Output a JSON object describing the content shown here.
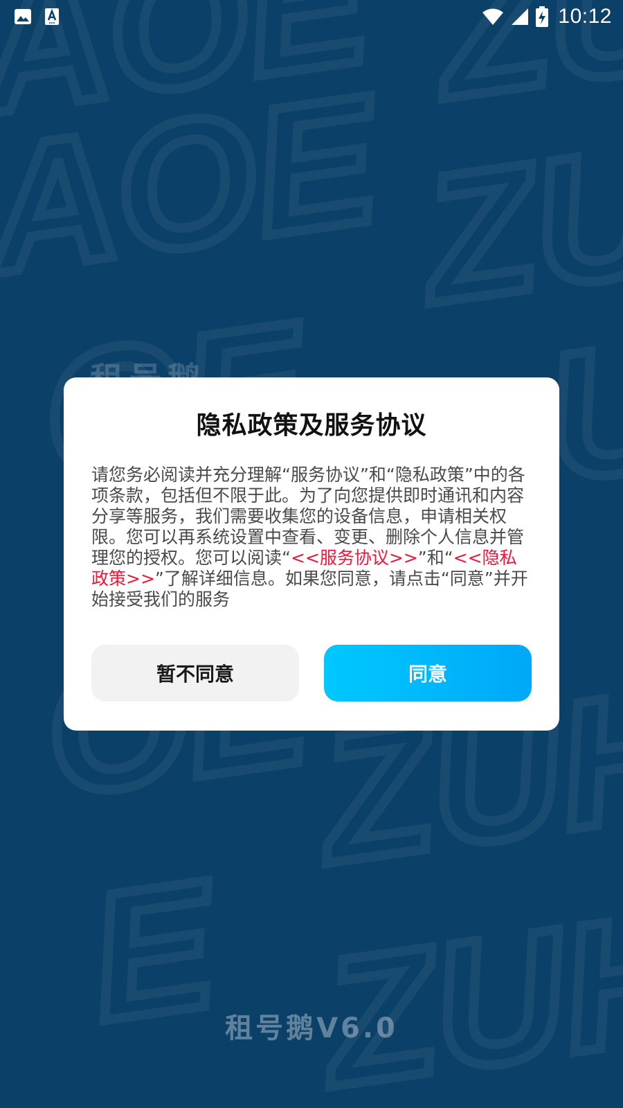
{
  "status_bar": {
    "time": "10:12",
    "left_icons": [
      "image-icon",
      "text-a-icon"
    ],
    "right_icons": [
      "wifi-icon",
      "signal-icon",
      "battery-charging-icon"
    ]
  },
  "background": {
    "watermark_text": "ZUHAOEZUHAOE",
    "brand_partial": "租号鹅"
  },
  "dialog": {
    "title": "隐私政策及服务协议",
    "body": {
      "part1": "请您务必阅读并充分理解“服务协议”和“隐私政策”中的各项条款，包括但不限于此。为了向您提供即时通讯和内容分享等服务，我们需要收集您的设备信息，申请相关权限。您可以再系统设置中查看、变更、删除个人信息并管理您的授权。您可以阅读“",
      "link1": "<<服务协议>>",
      "part2": "”和“",
      "link2": "<<隐私政策>>",
      "part3": "”了解详细信息。如果您同意，请点击“同意”并开始接受我们的服务"
    },
    "decline_label": "暂不同意",
    "agree_label": "同意"
  },
  "footer": {
    "app_version": "租号鹅V6.0"
  },
  "colors": {
    "background": "#0b4068",
    "link": "#f0163a",
    "agree_gradient_start": "#00c8ff",
    "agree_gradient_end": "#00a8f8",
    "decline_bg": "#f2f2f2"
  }
}
